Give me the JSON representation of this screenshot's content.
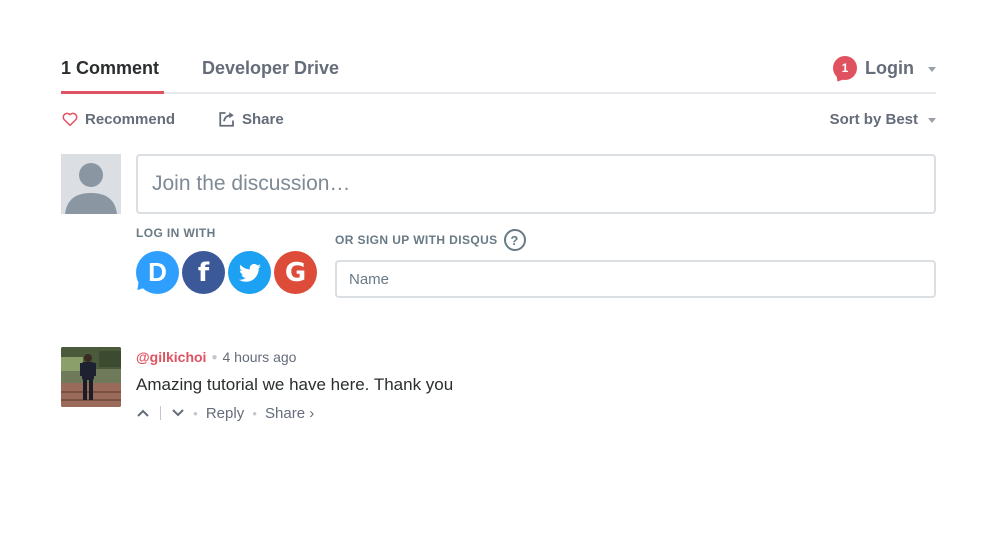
{
  "nav": {
    "comment_count_tab": "1 Comment",
    "community_tab": "Developer Drive",
    "notification_count": "1",
    "login_label": "Login"
  },
  "actions": {
    "recommend_label": "Recommend",
    "share_label": "Share",
    "sort_label": "Sort by Best"
  },
  "composer": {
    "placeholder": "Join the discussion…",
    "login_with_label": "LOG IN WITH",
    "social_logins": [
      {
        "name": "Disqus",
        "glyph": "D",
        "color": "#2e9fff"
      },
      {
        "name": "Facebook",
        "glyph": "f",
        "color": "#3b5998"
      },
      {
        "name": "Twitter",
        "glyph": "twitter-bird-icon",
        "color": "#1da1f2"
      },
      {
        "name": "Google",
        "glyph": "G",
        "color": "#dd4b39"
      }
    ],
    "signup_label": "OR SIGN UP WITH DISQUS",
    "help_glyph": "?",
    "name_placeholder": "Name"
  },
  "comments": [
    {
      "author": "@gilkichoi",
      "time": "4 hours ago",
      "body": "Amazing tutorial we have here. Thank you",
      "reply_label": "Reply",
      "share_label": "Share ›"
    }
  ],
  "colors": {
    "accent": "#e05260",
    "text": "#2a2e2e",
    "muted": "#656c7a",
    "border": "#dbdfe4"
  }
}
